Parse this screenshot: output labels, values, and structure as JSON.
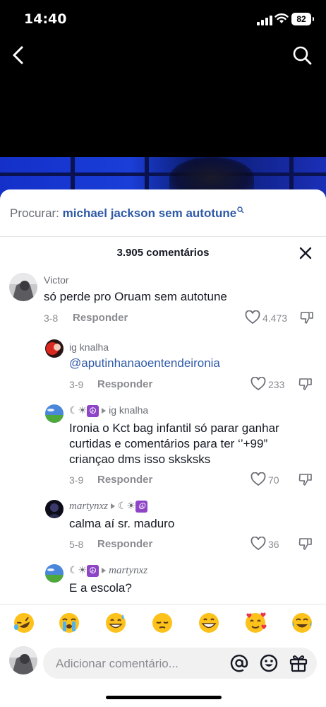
{
  "status": {
    "time": "14:40",
    "battery": "82"
  },
  "search": {
    "label": "Procurar:",
    "query": "michael jackson sem autotune"
  },
  "comments_header": {
    "count": "3.905 comentários"
  },
  "comments": [
    {
      "user": "Victor",
      "text": "só perde pro Oruam sem autotune",
      "date": "3-8",
      "reply": "Responder",
      "likes": "4.473"
    },
    {
      "user": "ig knalha",
      "text": "@aputinhanaoentendeironia",
      "date": "3-9",
      "reply": "Responder",
      "likes": "233"
    },
    {
      "user": "☾☀",
      "reply_to": "ig knalha",
      "text_lines": [
        "Ironia o Kct bag infantil só parar ganhar",
        "curtidas e comentários para ter ‘’+99”",
        "criançao dms isso sksksks"
      ],
      "date": "3-9",
      "reply": "Responder",
      "likes": "70"
    },
    {
      "user": "martynxz",
      "reply_to": "☾☀",
      "text": "calma aí sr. maduro",
      "date": "5-8",
      "reply": "Responder",
      "likes": "36"
    },
    {
      "user": "☾☀",
      "reply_to": "martynxz",
      "text": "E a escola?"
    }
  ],
  "emojis": [
    "🤣",
    "😭",
    "😅",
    "😔",
    "😁",
    "🥰",
    "😂"
  ],
  "composer": {
    "placeholder": "Adicionar comentário..."
  },
  "icons": [
    "back-icon",
    "search-icon",
    "close-icon",
    "heart-icon",
    "dislike-icon",
    "at-icon",
    "emoji-icon",
    "gift-icon"
  ]
}
